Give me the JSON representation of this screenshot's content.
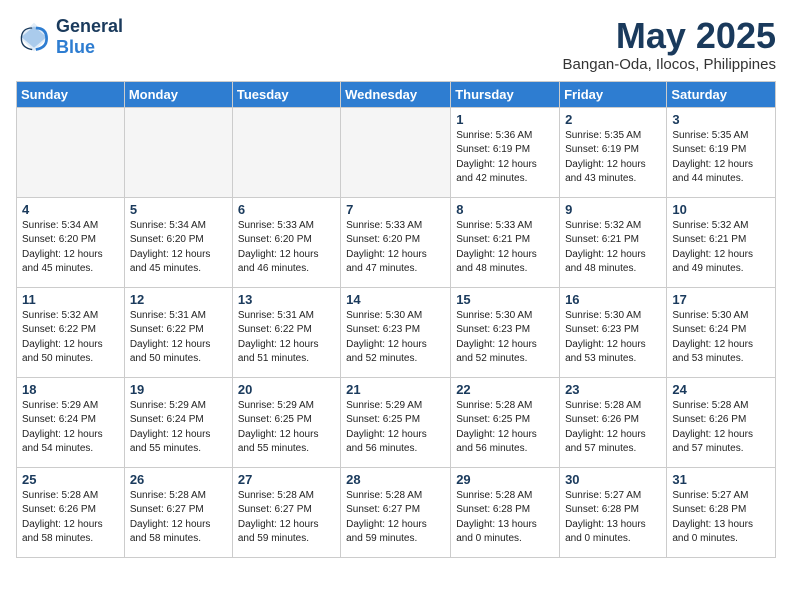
{
  "header": {
    "logo_line1": "General",
    "logo_line2": "Blue",
    "month": "May 2025",
    "location": "Bangan-Oda, Ilocos, Philippines"
  },
  "days_of_week": [
    "Sunday",
    "Monday",
    "Tuesday",
    "Wednesday",
    "Thursday",
    "Friday",
    "Saturday"
  ],
  "weeks": [
    [
      {
        "day": "",
        "info": ""
      },
      {
        "day": "",
        "info": ""
      },
      {
        "day": "",
        "info": ""
      },
      {
        "day": "",
        "info": ""
      },
      {
        "day": "1",
        "info": "Sunrise: 5:36 AM\nSunset: 6:19 PM\nDaylight: 12 hours\nand 42 minutes."
      },
      {
        "day": "2",
        "info": "Sunrise: 5:35 AM\nSunset: 6:19 PM\nDaylight: 12 hours\nand 43 minutes."
      },
      {
        "day": "3",
        "info": "Sunrise: 5:35 AM\nSunset: 6:19 PM\nDaylight: 12 hours\nand 44 minutes."
      }
    ],
    [
      {
        "day": "4",
        "info": "Sunrise: 5:34 AM\nSunset: 6:20 PM\nDaylight: 12 hours\nand 45 minutes."
      },
      {
        "day": "5",
        "info": "Sunrise: 5:34 AM\nSunset: 6:20 PM\nDaylight: 12 hours\nand 45 minutes."
      },
      {
        "day": "6",
        "info": "Sunrise: 5:33 AM\nSunset: 6:20 PM\nDaylight: 12 hours\nand 46 minutes."
      },
      {
        "day": "7",
        "info": "Sunrise: 5:33 AM\nSunset: 6:20 PM\nDaylight: 12 hours\nand 47 minutes."
      },
      {
        "day": "8",
        "info": "Sunrise: 5:33 AM\nSunset: 6:21 PM\nDaylight: 12 hours\nand 48 minutes."
      },
      {
        "day": "9",
        "info": "Sunrise: 5:32 AM\nSunset: 6:21 PM\nDaylight: 12 hours\nand 48 minutes."
      },
      {
        "day": "10",
        "info": "Sunrise: 5:32 AM\nSunset: 6:21 PM\nDaylight: 12 hours\nand 49 minutes."
      }
    ],
    [
      {
        "day": "11",
        "info": "Sunrise: 5:32 AM\nSunset: 6:22 PM\nDaylight: 12 hours\nand 50 minutes."
      },
      {
        "day": "12",
        "info": "Sunrise: 5:31 AM\nSunset: 6:22 PM\nDaylight: 12 hours\nand 50 minutes."
      },
      {
        "day": "13",
        "info": "Sunrise: 5:31 AM\nSunset: 6:22 PM\nDaylight: 12 hours\nand 51 minutes."
      },
      {
        "day": "14",
        "info": "Sunrise: 5:30 AM\nSunset: 6:23 PM\nDaylight: 12 hours\nand 52 minutes."
      },
      {
        "day": "15",
        "info": "Sunrise: 5:30 AM\nSunset: 6:23 PM\nDaylight: 12 hours\nand 52 minutes."
      },
      {
        "day": "16",
        "info": "Sunrise: 5:30 AM\nSunset: 6:23 PM\nDaylight: 12 hours\nand 53 minutes."
      },
      {
        "day": "17",
        "info": "Sunrise: 5:30 AM\nSunset: 6:24 PM\nDaylight: 12 hours\nand 53 minutes."
      }
    ],
    [
      {
        "day": "18",
        "info": "Sunrise: 5:29 AM\nSunset: 6:24 PM\nDaylight: 12 hours\nand 54 minutes."
      },
      {
        "day": "19",
        "info": "Sunrise: 5:29 AM\nSunset: 6:24 PM\nDaylight: 12 hours\nand 55 minutes."
      },
      {
        "day": "20",
        "info": "Sunrise: 5:29 AM\nSunset: 6:25 PM\nDaylight: 12 hours\nand 55 minutes."
      },
      {
        "day": "21",
        "info": "Sunrise: 5:29 AM\nSunset: 6:25 PM\nDaylight: 12 hours\nand 56 minutes."
      },
      {
        "day": "22",
        "info": "Sunrise: 5:28 AM\nSunset: 6:25 PM\nDaylight: 12 hours\nand 56 minutes."
      },
      {
        "day": "23",
        "info": "Sunrise: 5:28 AM\nSunset: 6:26 PM\nDaylight: 12 hours\nand 57 minutes."
      },
      {
        "day": "24",
        "info": "Sunrise: 5:28 AM\nSunset: 6:26 PM\nDaylight: 12 hours\nand 57 minutes."
      }
    ],
    [
      {
        "day": "25",
        "info": "Sunrise: 5:28 AM\nSunset: 6:26 PM\nDaylight: 12 hours\nand 58 minutes."
      },
      {
        "day": "26",
        "info": "Sunrise: 5:28 AM\nSunset: 6:27 PM\nDaylight: 12 hours\nand 58 minutes."
      },
      {
        "day": "27",
        "info": "Sunrise: 5:28 AM\nSunset: 6:27 PM\nDaylight: 12 hours\nand 59 minutes."
      },
      {
        "day": "28",
        "info": "Sunrise: 5:28 AM\nSunset: 6:27 PM\nDaylight: 12 hours\nand 59 minutes."
      },
      {
        "day": "29",
        "info": "Sunrise: 5:28 AM\nSunset: 6:28 PM\nDaylight: 13 hours\nand 0 minutes."
      },
      {
        "day": "30",
        "info": "Sunrise: 5:27 AM\nSunset: 6:28 PM\nDaylight: 13 hours\nand 0 minutes."
      },
      {
        "day": "31",
        "info": "Sunrise: 5:27 AM\nSunset: 6:28 PM\nDaylight: 13 hours\nand 0 minutes."
      }
    ]
  ]
}
